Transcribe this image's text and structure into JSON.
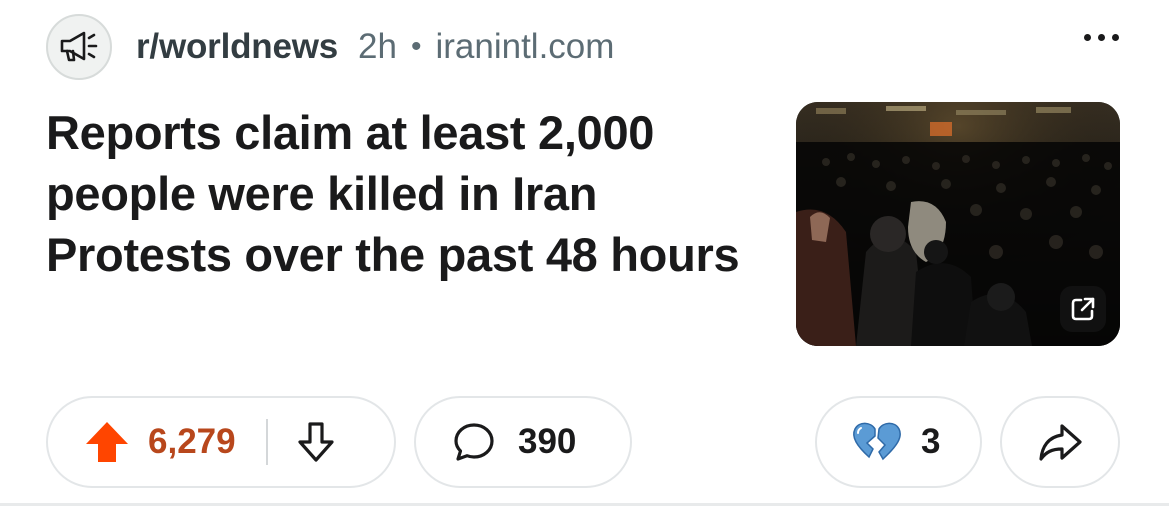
{
  "post": {
    "subreddit": "r/worldnews",
    "age": "2h",
    "separator": "•",
    "domain": "iranintl.com",
    "title": "Reports claim at least 2,000 people were killed in Iran Protests over the past 48 hours",
    "thumbnail_icon": "external-link-icon",
    "subreddit_icon": "megaphone-icon"
  },
  "actions": {
    "score": "6,279",
    "comments": "390",
    "awards": "3",
    "award_icon": "broken-heart-icon",
    "share_icon": "share-arrow-icon"
  },
  "colors": {
    "upvote": "#ff4500",
    "score": "#b8471c",
    "award": "#5b9bd5",
    "border": "#e3e6e8"
  }
}
